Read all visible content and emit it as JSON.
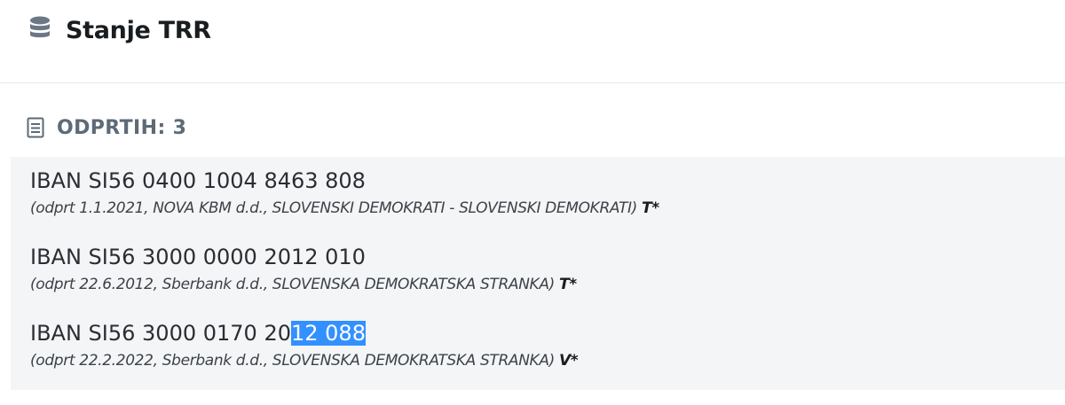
{
  "header": {
    "title": "Stanje TRR",
    "icon": "database-icon"
  },
  "section": {
    "label": "ODPRTIH:",
    "count": "3",
    "icon": "list-icon"
  },
  "accounts": [
    {
      "iban": "IBAN SI56 0400 1004 8463 808",
      "detail": "(odprt 1.1.2021, NOVA KBM d.d., SLOVENSKI DEMOKRATI - SLOVENSKI DEMOKRATI)",
      "flag": "T*"
    },
    {
      "iban": "IBAN SI56 3000 0000 2012 010",
      "detail": "(odprt 22.6.2012, Sberbank d.d., SLOVENSKA DEMOKRATSKA STRANKA)",
      "flag": "T*"
    },
    {
      "iban_plain": "IBAN SI56 3000 0170 20",
      "iban_selected": "12 088",
      "detail": "(odprt 22.2.2022, Sberbank d.d., SLOVENSKA DEMOKRATSKA STRANKA)",
      "flag": "V*"
    }
  ],
  "colors": {
    "selection": "#3390ff",
    "panel_background": "#f3f5f7",
    "heading_gray": "#5d6a77"
  }
}
